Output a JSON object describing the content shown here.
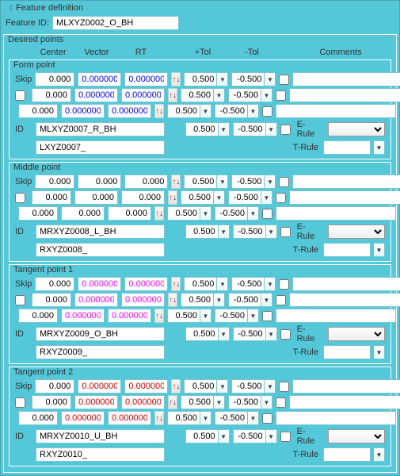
{
  "header": {
    "title": "Feature definition"
  },
  "feature": {
    "id_label": "Feature ID:",
    "id": "MLXYZ0002_O_BH"
  },
  "desired": {
    "title": "Desired points",
    "cols": {
      "center": "Center",
      "vector": "Vector",
      "rt": "RT",
      "ptol": "+Tol",
      "mtol": "-Tol",
      "comments": "Comments"
    },
    "skip_label": "Skip",
    "id_label": "ID",
    "erule_label": "E-Rule",
    "trule_label": "T-Rule",
    "points": [
      {
        "legend": "Form point",
        "color": "blue",
        "rows": [
          {
            "center": "0.000",
            "vector": "0.000000",
            "rt": "0.000000",
            "ptol": "0.500",
            "mtol": "-0.500",
            "comment": ""
          },
          {
            "center": "0.000",
            "vector": "0.000000",
            "rt": "0.000000",
            "ptol": "0.500",
            "mtol": "-0.500",
            "comment": ""
          },
          {
            "center": "0.000",
            "vector": "0.000000",
            "rt": "0.000000",
            "ptol": "0.500",
            "mtol": "-0.500",
            "comment": ""
          }
        ],
        "id": "MLXYZ0007_R_BH",
        "id2": "LXYZ0007_",
        "id_ptol": "0.500",
        "id_mtol": "-0.500",
        "erule": "",
        "trule": ""
      },
      {
        "legend": "Middle point",
        "color": "black",
        "rows": [
          {
            "center": "0.000",
            "vector": "0.000",
            "rt": "0.000",
            "ptol": "0.500",
            "mtol": "-0.500",
            "comment": ""
          },
          {
            "center": "0.000",
            "vector": "0.000",
            "rt": "0.000",
            "ptol": "0.500",
            "mtol": "-0.500",
            "comment": ""
          },
          {
            "center": "0.000",
            "vector": "0.000",
            "rt": "0.000",
            "ptol": "0.500",
            "mtol": "-0.500",
            "comment": ""
          }
        ],
        "id": "MRXYZ0008_L_BH",
        "id2": "RXYZ0008_",
        "id_ptol": "0.500",
        "id_mtol": "-0.500",
        "erule": "",
        "trule": ""
      },
      {
        "legend": "Tangent point 1",
        "color": "magenta",
        "rows": [
          {
            "center": "0.000",
            "vector": "0.000000",
            "rt": "0.000000",
            "ptol": "0.500",
            "mtol": "-0.500",
            "comment": ""
          },
          {
            "center": "0.000",
            "vector": "0.000000",
            "rt": "0.000000",
            "ptol": "0.500",
            "mtol": "-0.500",
            "comment": ""
          },
          {
            "center": "0.000",
            "vector": "0.000000",
            "rt": "0.000000",
            "ptol": "0.500",
            "mtol": "-0.500",
            "comment": ""
          }
        ],
        "id": "MRXYZ0009_O_BH",
        "id2": "RXYZ0009_",
        "id_ptol": "0.500",
        "id_mtol": "-0.500",
        "erule": "",
        "trule": ""
      },
      {
        "legend": "Tangent point 2",
        "color": "red",
        "rows": [
          {
            "center": "0.000",
            "vector": "0.000000",
            "rt": "0.000000",
            "ptol": "0.500",
            "mtol": "-0.500",
            "comment": ""
          },
          {
            "center": "0.000",
            "vector": "0.000000",
            "rt": "0.000000",
            "ptol": "0.500",
            "mtol": "-0.500",
            "comment": ""
          },
          {
            "center": "0.000",
            "vector": "0.000000",
            "rt": "0.000000",
            "ptol": "0.500",
            "mtol": "-0.500",
            "comment": ""
          }
        ],
        "id": "MRXYZ0010_U_BH",
        "id2": "RXYZ0010_",
        "id_ptol": "0.500",
        "id_mtol": "-0.500",
        "erule": "",
        "trule": ""
      }
    ]
  }
}
